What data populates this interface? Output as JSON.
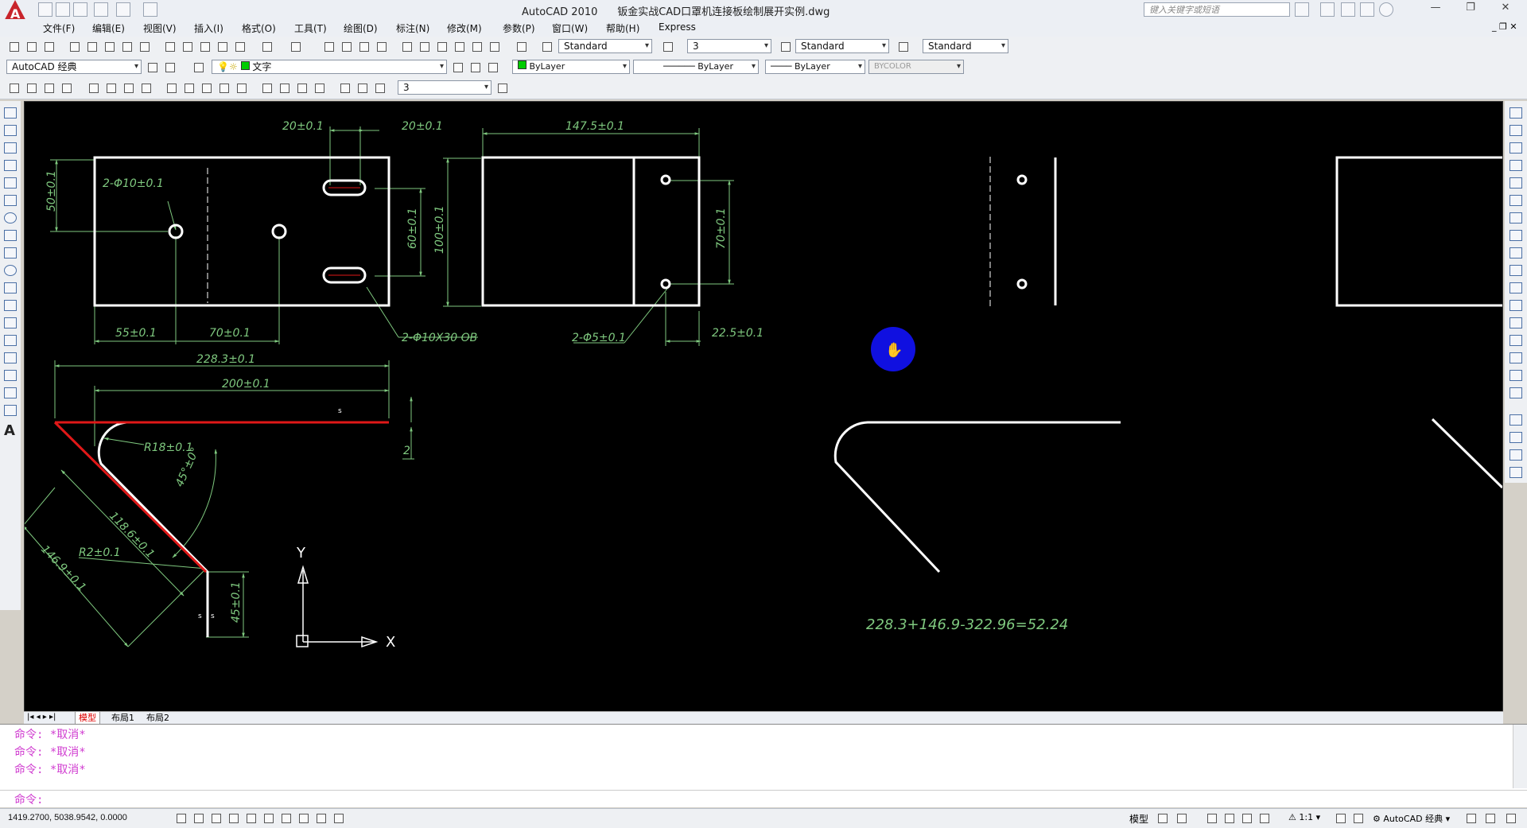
{
  "window": {
    "app_name": "AutoCAD 2010",
    "file_name": "钣金实战CAD口罩机连接板绘制展开实例.dwg",
    "search_placeholder": "键入关键字或短语"
  },
  "menu": [
    "文件(F)",
    "编辑(E)",
    "视图(V)",
    "插入(I)",
    "格式(O)",
    "工具(T)",
    "绘图(D)",
    "标注(N)",
    "修改(M)",
    "参数(P)",
    "窗口(W)",
    "帮助(H)",
    "Express"
  ],
  "toolbar1": {
    "text_style": "Standard",
    "dim_scale": "3",
    "dim_style": "Standard",
    "table_style": "Standard"
  },
  "toolbar2": {
    "workspace": "AutoCAD 经典",
    "layer": "文字",
    "color": "ByLayer",
    "linetype": "ByLayer",
    "lineweight": "ByLayer",
    "plotstyle": "BYCOLOR"
  },
  "toolbar3": {
    "dim_value": "3"
  },
  "drawing": {
    "dims": {
      "d_20a": "20±0.1",
      "d_20b": "20±0.1",
      "d_1475": "147.5±0.1",
      "d_50": "50±0.1",
      "d_holes": "2-Φ10±0.1",
      "d_60": "60±0.1",
      "d_100": "100±0.1",
      "d_70v": "70±0.1",
      "d_55": "55±0.1",
      "d_70h": "70±0.1",
      "d_slot": "2-Φ10X30 OB",
      "d_2phi5": "2-Φ5±0.1",
      "d_225": "22.5±0.1",
      "d_2283": "228.3±0.1",
      "d_200": "200±0.1",
      "d_r18": "R18±0.1",
      "d_45deg": "45°±0°",
      "d_1186": "118.6±0.1",
      "d_1469": "146.9±0.1",
      "d_r2": "R2±0.1",
      "d_45": "45±0.1",
      "d_2": "2",
      "d_s": "s",
      "formula": "228.3+146.9-322.96=52.24",
      "axis_x": "X",
      "axis_y": "Y"
    },
    "colors": {
      "background": "#000000",
      "geometry": "#ffffff",
      "dimension": "#7fc97f",
      "highlight": "#e01818",
      "cursor": "#1010e0"
    }
  },
  "tabs": [
    "模型",
    "布局1",
    "布局2"
  ],
  "command": {
    "history": [
      "命令: *取消*",
      "命令: *取消*",
      "命令: *取消*"
    ],
    "prompt": "命令:"
  },
  "status": {
    "coords": "1419.2700, 5038.9542, 0.0000",
    "model_label": "模型",
    "annotation_scale": "1:1",
    "workspace": "AutoCAD 经典"
  }
}
